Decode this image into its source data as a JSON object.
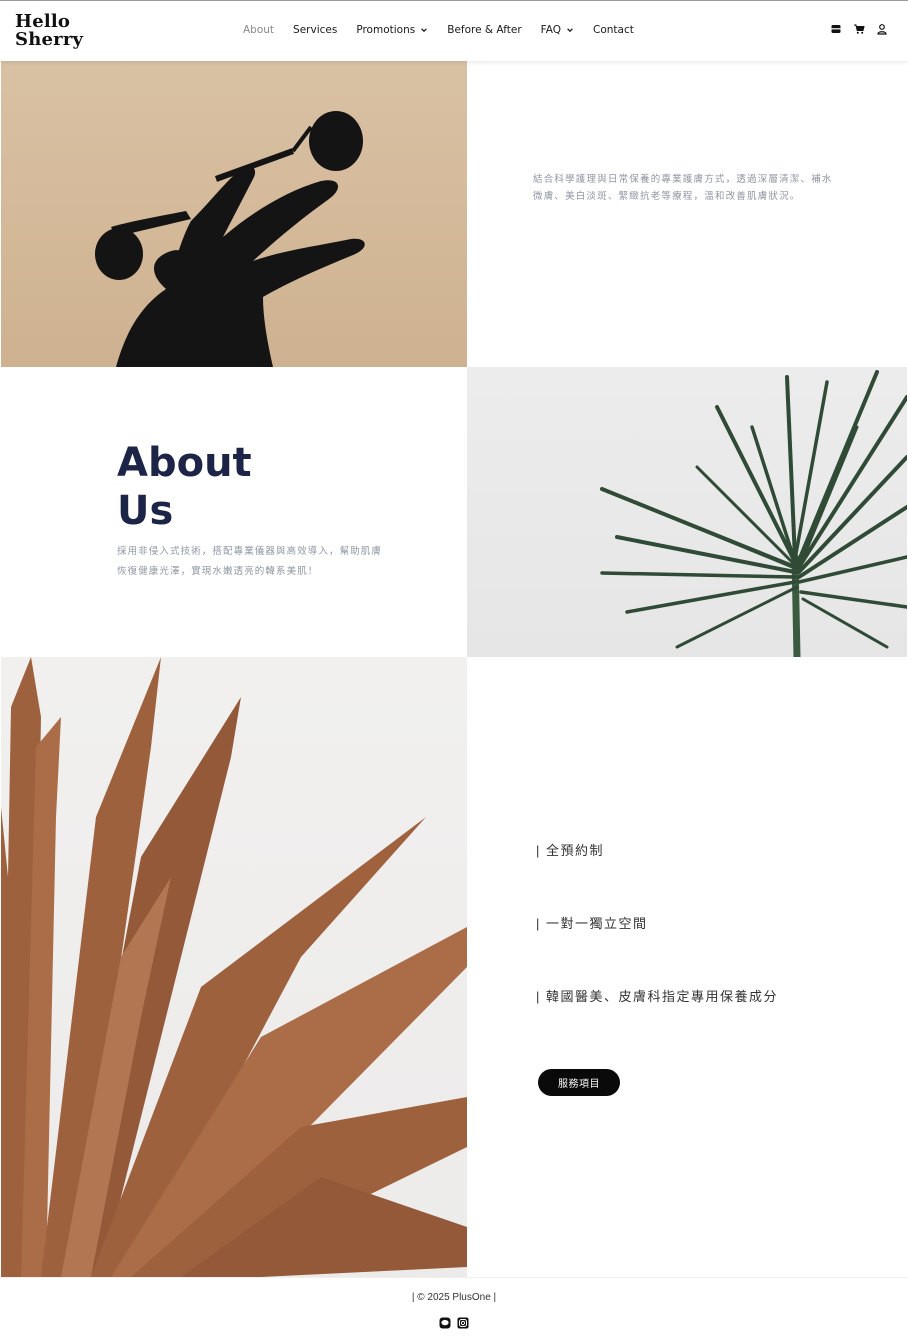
{
  "brand": {
    "line1": "Hello",
    "line2": "Sherry"
  },
  "nav": [
    {
      "label": "About",
      "dropdown": false,
      "active": true
    },
    {
      "label": "Services",
      "dropdown": false,
      "active": false
    },
    {
      "label": "Promotions",
      "dropdown": true,
      "active": false
    },
    {
      "label": "Before & After",
      "dropdown": false,
      "active": false
    },
    {
      "label": "FAQ",
      "dropdown": true,
      "active": false
    },
    {
      "label": "Contact",
      "dropdown": false,
      "active": false
    }
  ],
  "header_icons": [
    "store-icon",
    "cart-icon",
    "user-icon"
  ],
  "intro": {
    "text": "結合科學護理與日常保養的專業護膚方式，透過深層清潔、補水微膚、美白淡斑、緊緻抗老等療程，溫和改善肌膚狀況。"
  },
  "about": {
    "title_line1": "About",
    "title_line2": "Us",
    "text": "採用非侵入式技術，搭配專業儀器與高效導入，幫助肌膚恢復健康光澤，實現水嫩透亮的韓系美肌！"
  },
  "features": [
    "| 全預約制",
    "| 一對一獨立空間",
    "| 韓國醫美、皮膚科指定專用保養成分"
  ],
  "service_button": "服務項目",
  "footer": {
    "copyright": "| © 2025 PlusOne |",
    "social_icons": [
      "line-icon",
      "instagram-icon"
    ]
  },
  "colors": {
    "title": "#1c2448",
    "muted_text": "#8f96a3",
    "button_bg": "#0a0a0a"
  }
}
